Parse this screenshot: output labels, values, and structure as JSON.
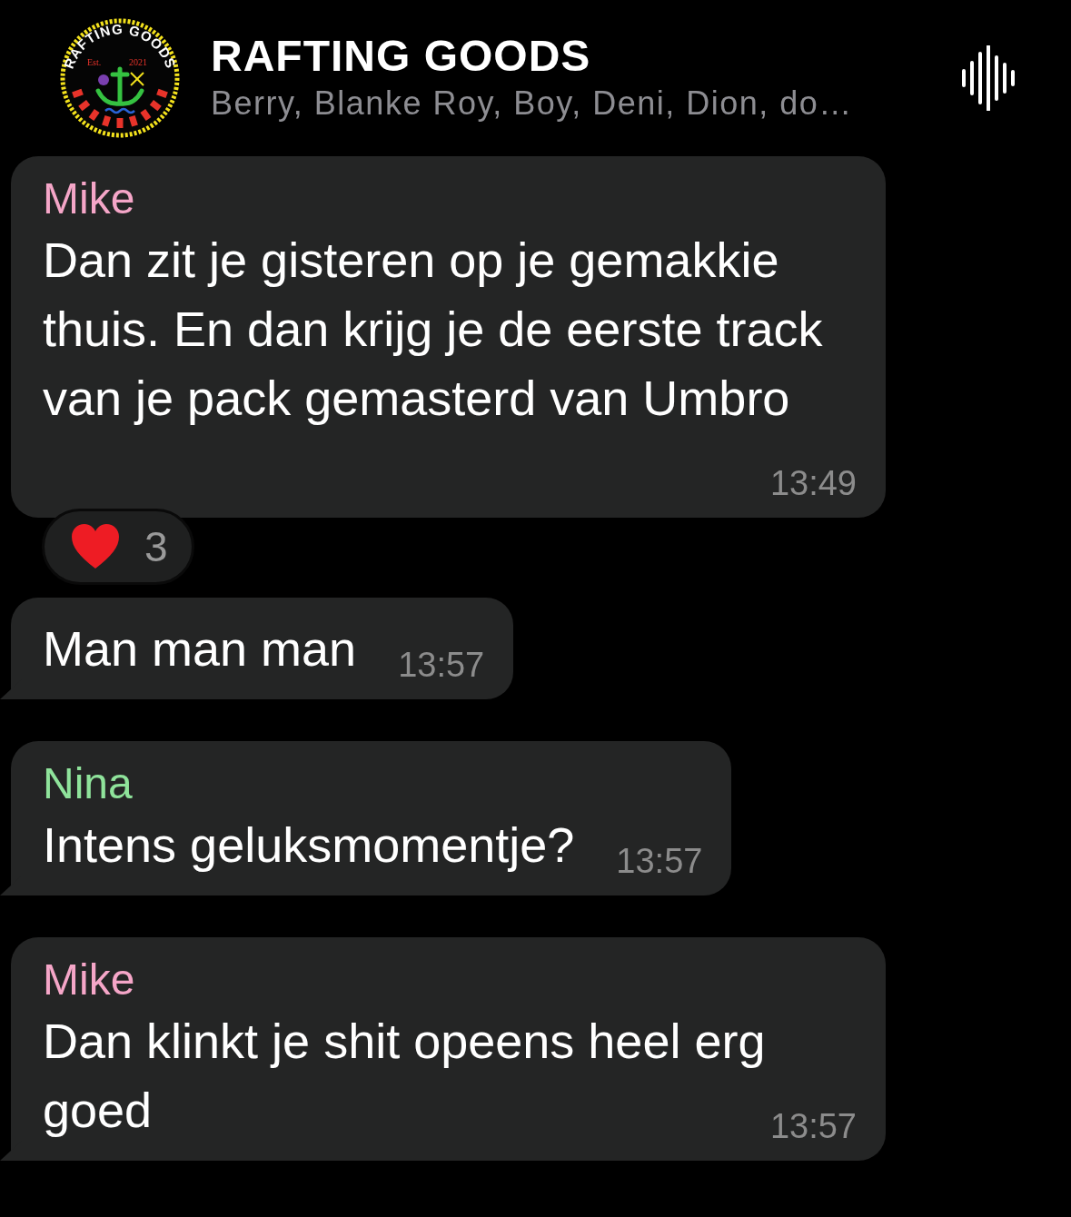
{
  "header": {
    "avatar": {
      "ring_text": "RAFTING GOODS",
      "est": "Est.",
      "year": "2021"
    },
    "title": "RAFTING GOODS",
    "subtitle": "Berry, Blanke Roy, Boy, Deni, Dion, do…"
  },
  "messages": [
    {
      "sender": "Mike",
      "color": "#f5a6c8",
      "text": "Dan zit je gisteren op je gemakkie thuis. En dan krijg je de eerste track van je pack gemasterd van Umbro",
      "time": "13:49",
      "tail": false,
      "reactions": [
        {
          "count": "3"
        }
      ]
    },
    {
      "text": "Man man man",
      "time": "13:57",
      "tail": true
    },
    {
      "sender": "Nina",
      "color": "#8fe39b",
      "text": "Intens geluksmomentje?",
      "time": "13:57",
      "tail": true
    },
    {
      "sender": "Mike",
      "color": "#f5a6c8",
      "text": "Dan klinkt je shit opeens heel erg goed",
      "time": "13:57",
      "tail": true
    }
  ]
}
